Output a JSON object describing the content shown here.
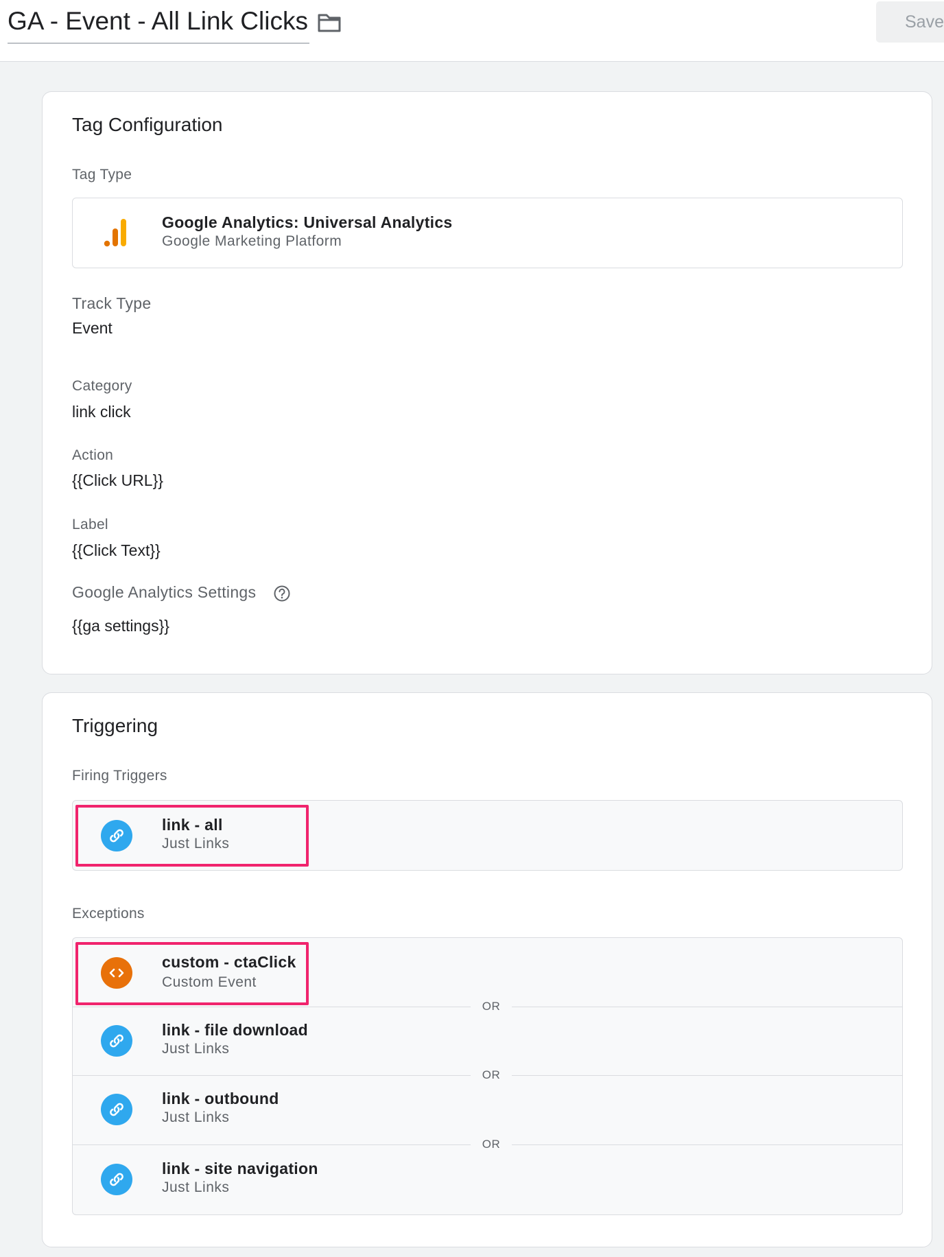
{
  "header": {
    "title": "GA - Event - All Link Clicks",
    "save_label": "Save",
    "folder_icon": "folder-icon"
  },
  "tag_config": {
    "title": "Tag Configuration",
    "tag_type_label": "Tag Type",
    "tag_type": {
      "name": "Google Analytics: Universal Analytics",
      "provider": "Google Marketing Platform",
      "icon": "google-analytics-icon"
    },
    "track_type_label": "Track Type",
    "track_type_value": "Event",
    "category_label": "Category",
    "category_value": "link click",
    "action_label": "Action",
    "action_value": "{{Click URL}}",
    "label_label": "Label",
    "label_value": "{{Click Text}}",
    "ga_settings_label": "Google Analytics Settings",
    "ga_settings_value": "{{ga settings}}",
    "help_icon": "help-icon"
  },
  "triggering": {
    "title": "Triggering",
    "firing_label": "Firing Triggers",
    "firing": [
      {
        "name": "link - all",
        "type": "Just Links",
        "icon": "link-icon"
      }
    ],
    "exceptions_label": "Exceptions",
    "or_label": "OR",
    "exceptions": [
      {
        "name": "custom - ctaClick",
        "type": "Custom Event",
        "icon": "code-icon"
      },
      {
        "name": "link - file download",
        "type": "Just Links",
        "icon": "link-icon"
      },
      {
        "name": "link - outbound",
        "type": "Just Links",
        "icon": "link-icon"
      },
      {
        "name": "link - site navigation",
        "type": "Just Links",
        "icon": "link-icon"
      }
    ]
  },
  "colors": {
    "link_trigger": "#2fa8ee",
    "custom_trigger": "#e8710a",
    "highlight": "#f0246d",
    "ga_orange": "#f9ab00",
    "ga_dark_orange": "#e37400"
  }
}
